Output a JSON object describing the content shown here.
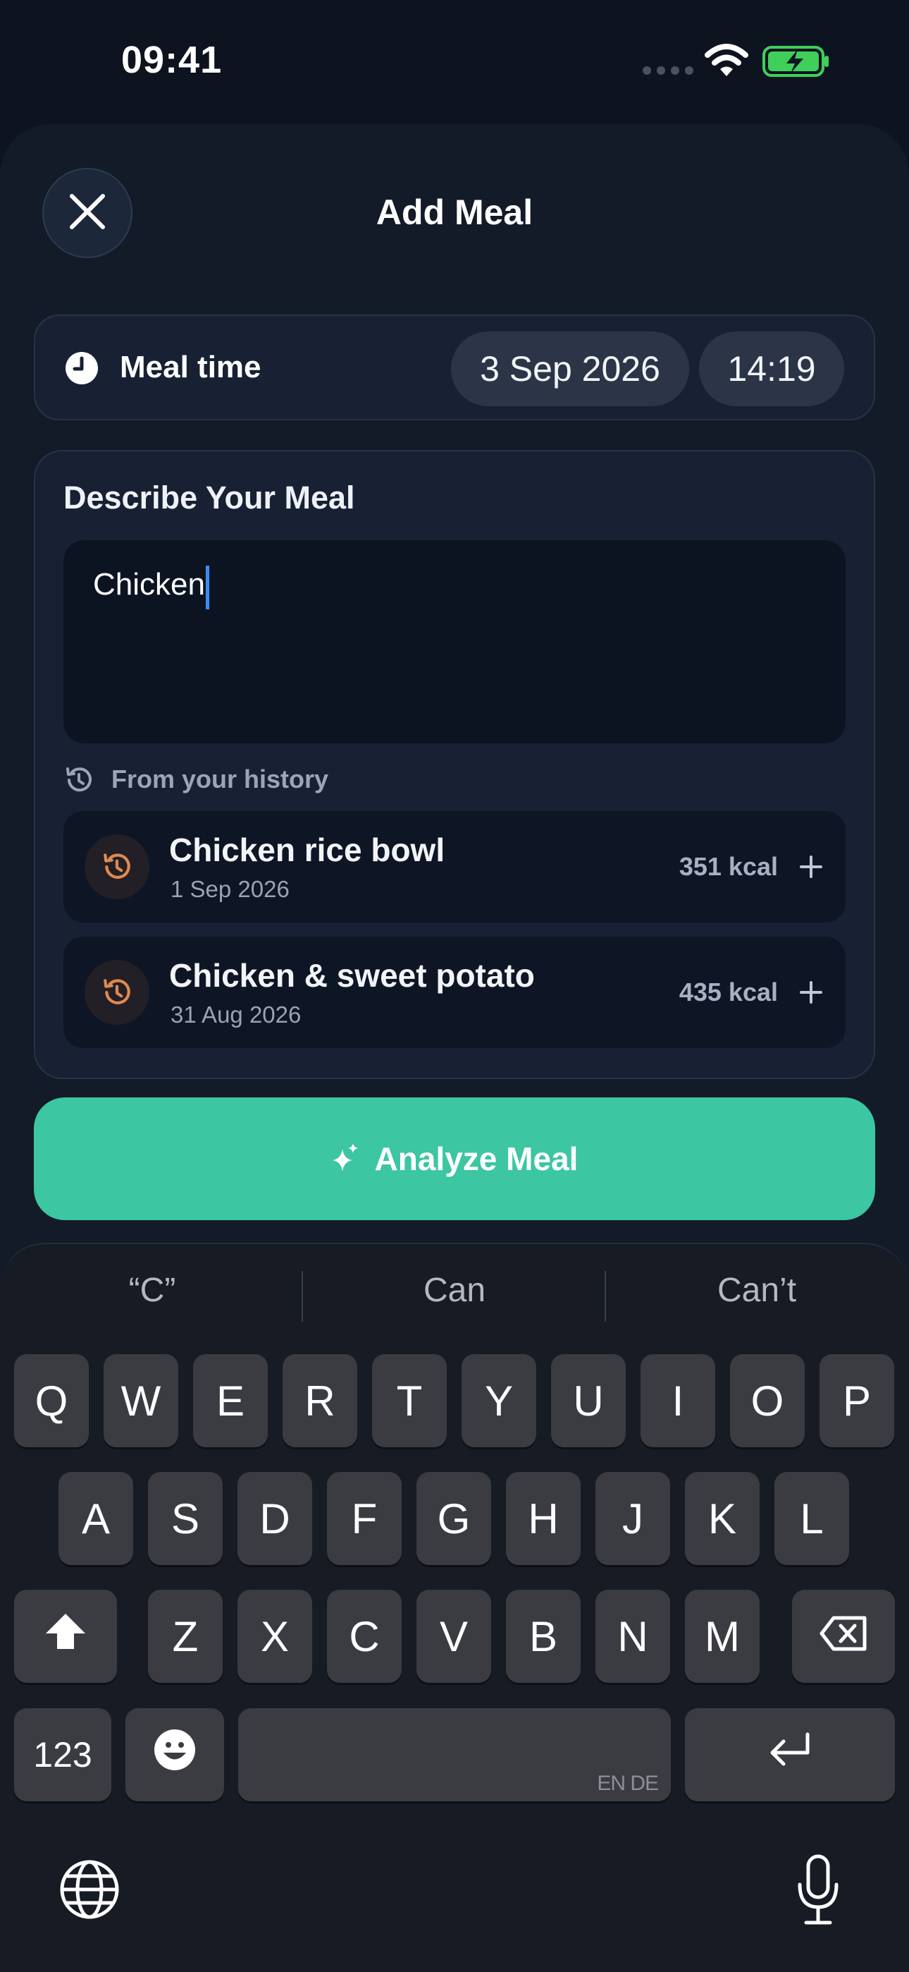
{
  "status_bar": {
    "time": "09:41"
  },
  "header": {
    "title": "Add Meal"
  },
  "meal_time": {
    "label": "Meal time",
    "date": "3 Sep 2026",
    "time": "14:19"
  },
  "describe": {
    "title": "Describe Your Meal",
    "input_value": "Chicken"
  },
  "history": {
    "label": "From your history",
    "items": [
      {
        "name": "Chicken rice bowl",
        "date": "1 Sep 2026",
        "kcal": "351 kcal"
      },
      {
        "name": "Chicken & sweet potato",
        "date": "31 Aug 2026",
        "kcal": "435 kcal"
      }
    ]
  },
  "analyze_button": {
    "label": "Analyze Meal"
  },
  "keyboard": {
    "suggestions": [
      "“C”",
      "Can",
      "Can’t"
    ],
    "row1": [
      "Q",
      "W",
      "E",
      "R",
      "T",
      "Y",
      "U",
      "I",
      "O",
      "P"
    ],
    "row2": [
      "A",
      "S",
      "D",
      "F",
      "G",
      "H",
      "J",
      "K",
      "L"
    ],
    "row3": [
      "Z",
      "X",
      "C",
      "V",
      "B",
      "N",
      "M"
    ],
    "numbers_key": "123",
    "space_hint": "EN DE"
  },
  "colors": {
    "background": "#0d1420",
    "card": "#172133",
    "accent": "#3cc6a2",
    "caret": "#3b8cf0",
    "history_icon": "#e08a4f",
    "battery": "#3fcf5a"
  }
}
